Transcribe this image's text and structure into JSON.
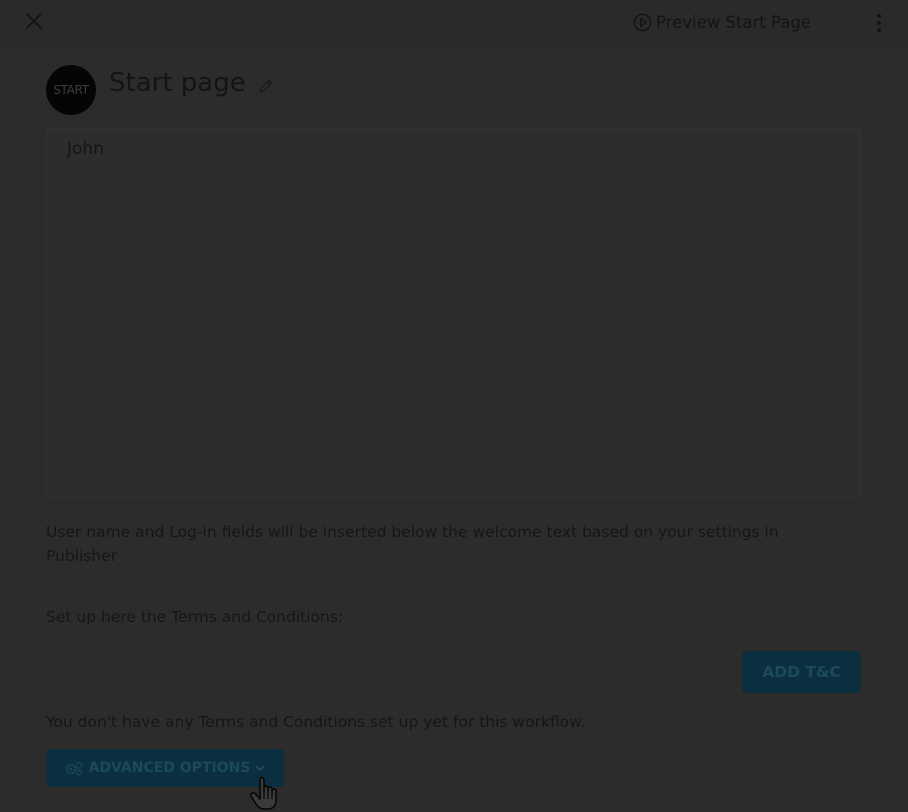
{
  "header": {
    "close_icon": "close-icon",
    "preview_label": "Preview Start Page",
    "preview_icon": "play-circle-icon",
    "menu_icon": "kebab-menu-icon"
  },
  "page": {
    "avatar_text": "START",
    "title": "Start page",
    "edit_icon": "pencil-icon"
  },
  "editor": {
    "content": "John"
  },
  "info": {
    "text": "User name and Log-in fields will be inserted below the welcome text based on your settings in Publisher"
  },
  "terms": {
    "label": "Set up here the Terms and Conditions:",
    "add_button": "ADD T&C",
    "empty_message": "You don't have any Terms and Conditions set up yet for this workflow."
  },
  "advanced": {
    "label": "ADVANCED OPTIONS",
    "icon": "cogs-icon",
    "chevron": "chevron-down-icon"
  },
  "colors": {
    "overlay_bg": "#2c2c2c",
    "button_bg": "#0b2f3e",
    "button_text": "#1a4a5c",
    "text": "#151515"
  }
}
